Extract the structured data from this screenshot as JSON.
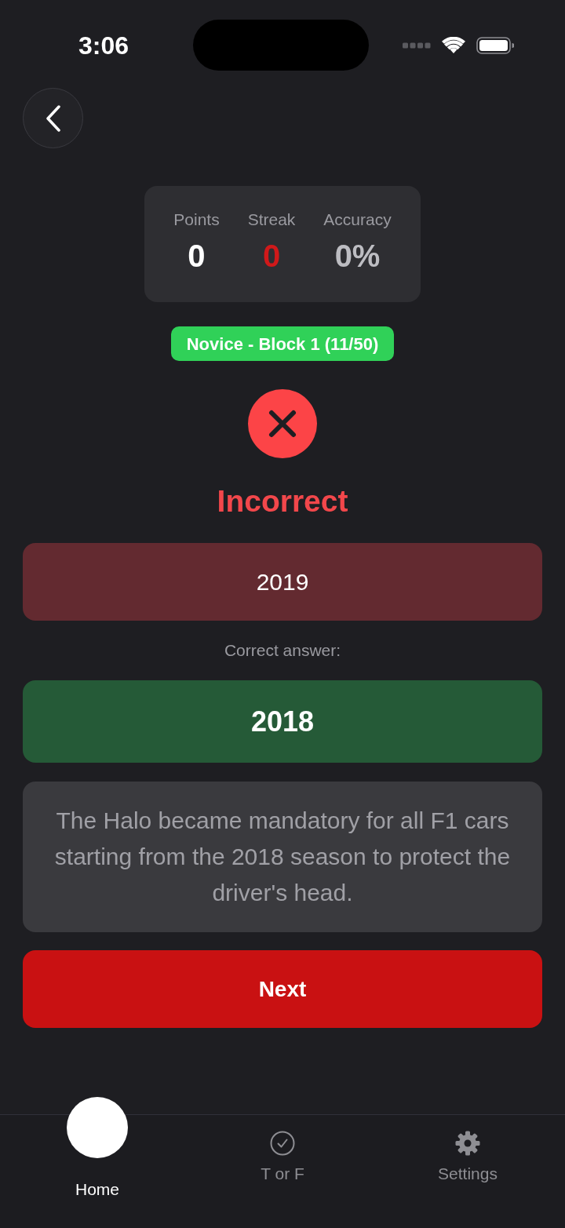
{
  "status_bar": {
    "time": "3:06"
  },
  "stats": [
    {
      "label": "Points",
      "value": "0",
      "color": "#ffffff"
    },
    {
      "label": "Streak",
      "value": "0",
      "color": "#d0191a"
    },
    {
      "label": "Accuracy",
      "value": "0%",
      "color": "#bdbdc2"
    }
  ],
  "level_badge": {
    "label": "Novice - Block 1 (11/50)"
  },
  "result": {
    "kind": "incorrect",
    "title": "Incorrect"
  },
  "selected_answer": {
    "label": "2019",
    "correct": false
  },
  "correct_answer_label": "Correct answer:",
  "correct_answer": {
    "label": "2018"
  },
  "explanation": "The Halo became mandatory for all F1 cars starting from the 2018 season to protect the driver's head.",
  "next_button": {
    "label": "Next"
  },
  "tab_bar": [
    {
      "kind": "home",
      "label": "Home",
      "selected": true
    },
    {
      "kind": "check",
      "label": "T or F",
      "selected": false
    },
    {
      "kind": "settings",
      "label": "Settings",
      "selected": false
    }
  ]
}
